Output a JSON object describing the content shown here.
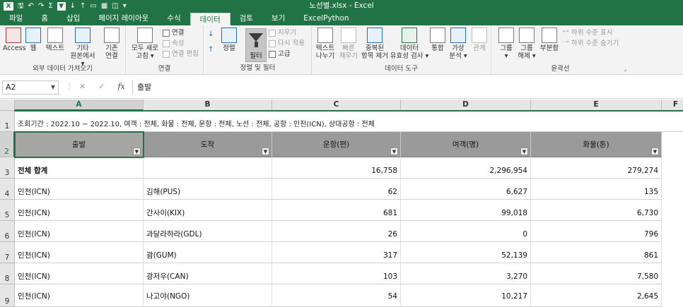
{
  "window": {
    "title": "노선별.xlsx - Excel"
  },
  "tabs": [
    {
      "label": "파일"
    },
    {
      "label": "홈"
    },
    {
      "label": "삽입"
    },
    {
      "label": "페이지 레이아웃"
    },
    {
      "label": "수식"
    },
    {
      "label": "데이터"
    },
    {
      "label": "검토"
    },
    {
      "label": "보기"
    },
    {
      "label": "ExcelPython"
    }
  ],
  "ribbon": {
    "external": {
      "label": "외부 데이터 가져오기",
      "access": "Access",
      "web": "웹",
      "text": "텍스트",
      "other1": "기타",
      "other2": "원본에서 ▾",
      "existing1": "기존",
      "existing2": "연결"
    },
    "connections": {
      "label": "연결",
      "refresh1": "모두 새로",
      "refresh2": "고침 ▾",
      "conn": "연결",
      "props": "속성",
      "edit": "연결 편집"
    },
    "sort": {
      "label": "정렬 및 필터",
      "sort": "정렬",
      "filter": "필터",
      "clear": "지우기",
      "reapply": "다시 적용",
      "advanced": "고급"
    },
    "tools": {
      "label": "데이터 도구",
      "t2c1": "텍스트",
      "t2c2": "나누기",
      "flash1": "빠른",
      "flash2": "채우기",
      "dup1": "중복된",
      "dup2": "항목 제거",
      "valid1": "데이터",
      "valid2": "유효성 검사 ▾",
      "consol": "통합",
      "whatif1": "가상",
      "whatif2": "분석 ▾",
      "rel": "관계"
    },
    "outline": {
      "label": "윤곽선",
      "group1": "그룹",
      "group2": "▾",
      "ungroup1": "그룹",
      "ungroup2": "해제 ▾",
      "subtotal": "부분합",
      "show": "하위 수준 표시",
      "hide": "하위 수준 숨기기"
    }
  },
  "formula_bar": {
    "name_box": "A2",
    "value": "출발"
  },
  "columns": [
    "A",
    "B",
    "C",
    "D",
    "E",
    "F"
  ],
  "rows": [
    "1",
    "2",
    "3",
    "4",
    "5",
    "6",
    "7",
    "8",
    "9"
  ],
  "info_text": "조회기간 : 2022.10 ~ 2022.10, 여객 : 전체, 화물 : 전체, 운항 : 전체, 노선 : 전체, 공항 : 인천(ICN), 상대공항 : 전체",
  "table": {
    "headers": [
      "출발",
      "도착",
      "운항(편)",
      "여객(명)",
      "화물(톤)"
    ],
    "rows": [
      [
        "전체 합계",
        "",
        "16,758",
        "2,296,954",
        "279,274"
      ],
      [
        "인천(ICN)",
        "김해(PUS)",
        "62",
        "6,627",
        "135"
      ],
      [
        "인천(ICN)",
        "간사이(KIX)",
        "681",
        "99,018",
        "6,730"
      ],
      [
        "인천(ICN)",
        "과달라하라(GDL)",
        "26",
        "0",
        "796"
      ],
      [
        "인천(ICN)",
        "괌(GUM)",
        "317",
        "52,139",
        "861"
      ],
      [
        "인천(ICN)",
        "광저우(CAN)",
        "103",
        "3,270",
        "7,580"
      ],
      [
        "인천(ICN)",
        "나고야(NGO)",
        "54",
        "10,217",
        "2,645"
      ]
    ]
  }
}
